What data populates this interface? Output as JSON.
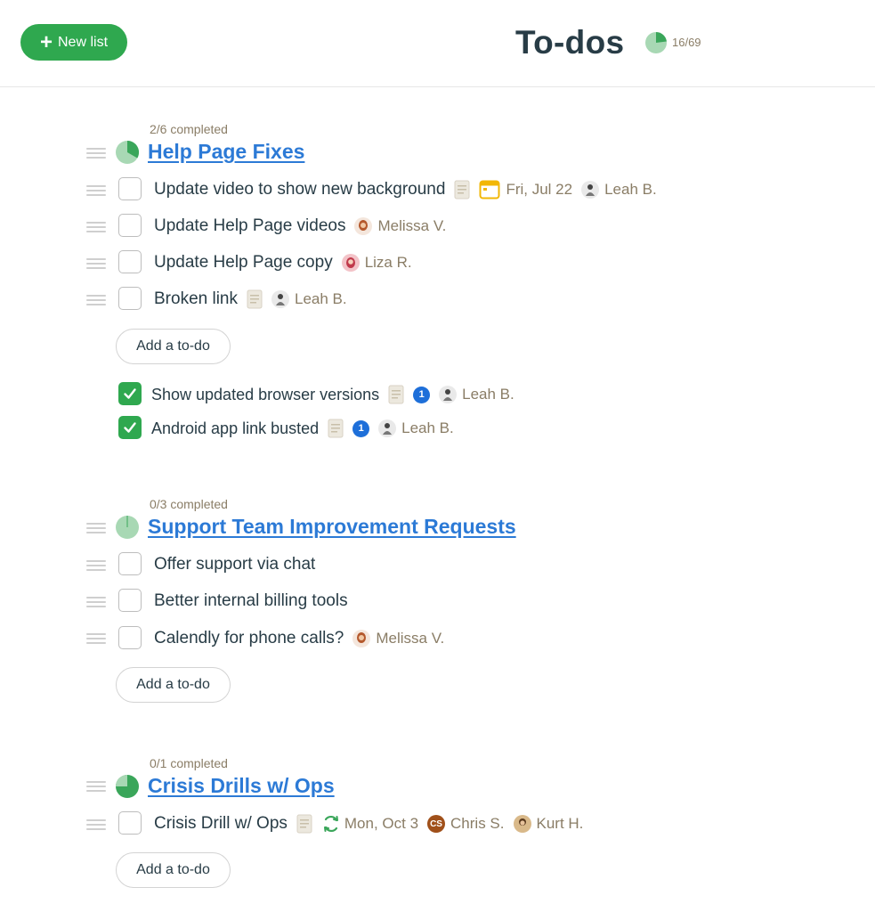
{
  "header": {
    "new_list_label": "New list",
    "title": "To-dos",
    "progress": "16/69",
    "progress_fraction": 0.232
  },
  "lists": [
    {
      "completed_text": "2/6 completed",
      "title": "Help Page Fixes",
      "pie_fraction": 0.333,
      "todos": [
        {
          "text": "Update video to show new background",
          "date": "Fri, Jul 22",
          "assignee": "Leah B."
        },
        {
          "text": "Update Help Page videos",
          "assignee": "Melissa V."
        },
        {
          "text": "Update Help Page copy",
          "assignee": "Liza R."
        },
        {
          "text": "Broken link",
          "assignee": "Leah B."
        }
      ],
      "add_label": "Add a to-do",
      "done": [
        {
          "text": "Show updated browser versions",
          "comments": "1",
          "assignee": "Leah B."
        },
        {
          "text": "Android app link busted",
          "comments": "1",
          "assignee": "Leah B."
        }
      ]
    },
    {
      "completed_text": "0/3 completed",
      "title": "Support Team Improvement Requests",
      "pie_fraction": 0.0,
      "todos": [
        {
          "text": "Offer support via chat"
        },
        {
          "text": "Better internal billing tools"
        },
        {
          "text": "Calendly for phone calls?",
          "assignee": "Melissa V."
        }
      ],
      "add_label": "Add a to-do"
    },
    {
      "completed_text": "0/1 completed",
      "title": "Crisis Drills w/ Ops",
      "pie_fraction": 0.75,
      "todos": [
        {
          "text": "Crisis Drill w/ Ops",
          "date": "Mon, Oct 3",
          "assignee": "Chris S.",
          "assignee_initials": "CS",
          "assignee2": "Kurt H."
        }
      ],
      "add_label": "Add a to-do"
    }
  ],
  "colors": {
    "accent_green": "#2fa84f",
    "pie_green": "#3aa65a",
    "pie_light": "#a8d8b4",
    "link_blue": "#2c7ad6",
    "meta_brown": "#8a7d66",
    "badge_blue": "#1e6fd9"
  },
  "icons": [
    "plus-icon",
    "progress-pie-icon",
    "drag-handle-icon",
    "note-icon",
    "calendar-icon",
    "repeat-icon",
    "comment-count-badge",
    "avatar"
  ]
}
